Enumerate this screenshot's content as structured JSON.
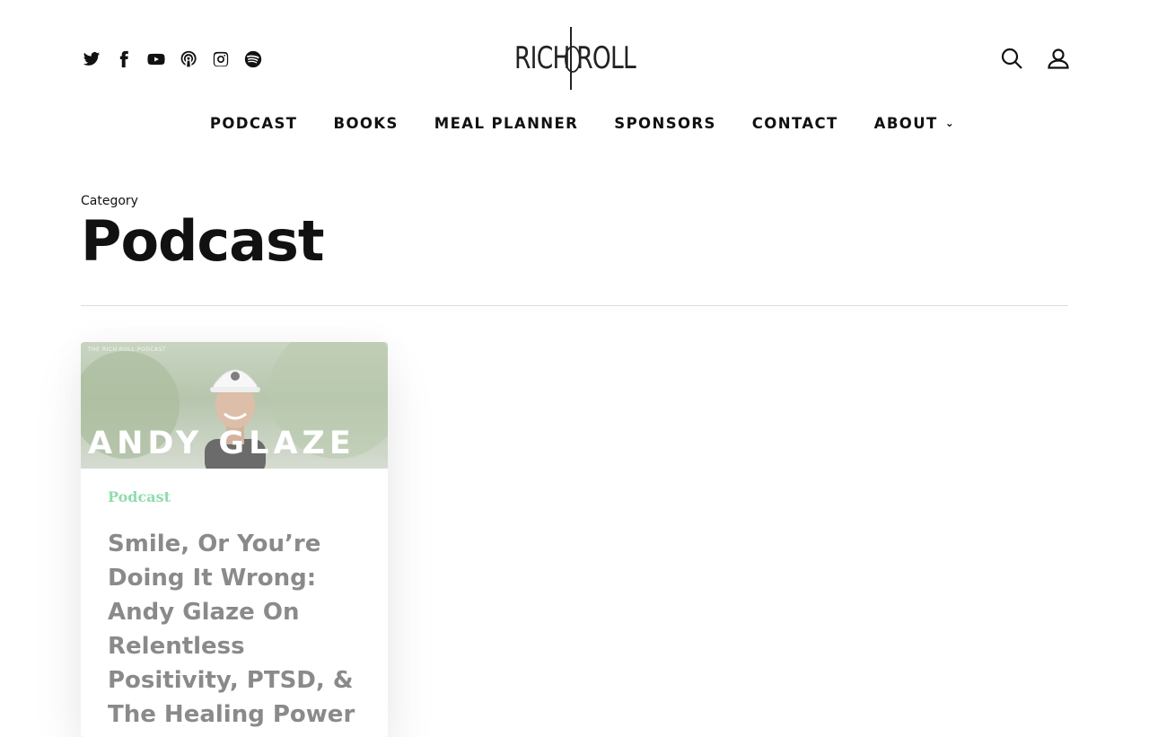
{
  "header": {
    "logo": "RICH ROLL",
    "social_icons": [
      "twitter-icon",
      "facebook-icon",
      "youtube-icon",
      "podcast-icon",
      "instagram-icon",
      "spotify-icon"
    ],
    "nav": [
      {
        "label": "PODCAST"
      },
      {
        "label": "BOOKS"
      },
      {
        "label": "MEAL PLANNER"
      },
      {
        "label": "SPONSORS"
      },
      {
        "label": "CONTACT"
      },
      {
        "label": "ABOUT"
      }
    ]
  },
  "category": {
    "label": "Category",
    "title": "Podcast"
  },
  "posts": [
    {
      "image_overlay_name": "ANDY GLAZE",
      "image_badge": "THE RICH ROLL PODCAST",
      "category": "Podcast",
      "title": "Smile, Or You’re Doing It Wrong: Andy Glaze On Relentless Positivity, PTSD, & The Healing Power"
    }
  ],
  "colors": {
    "accent_category": "#8fdcae",
    "text": "#111111",
    "card_title": "#8a8a8a"
  }
}
